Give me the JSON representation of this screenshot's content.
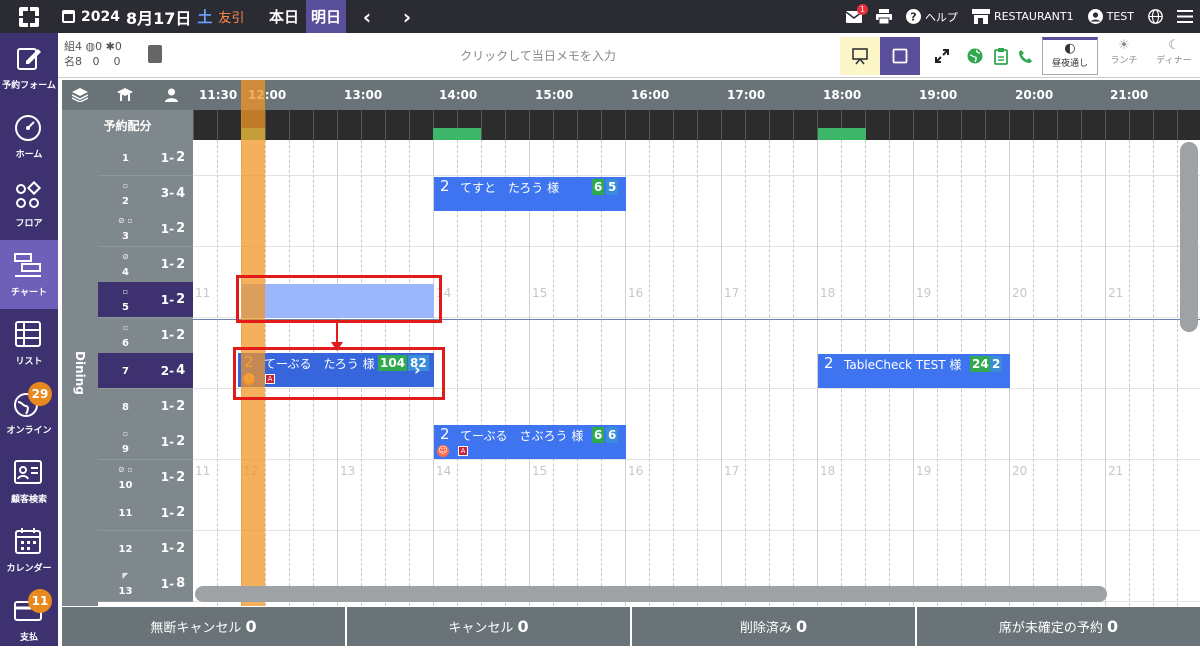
{
  "header": {
    "year": "2024",
    "month_day": "8月17日",
    "weekday": "土",
    "rokuyo": "友引",
    "today_label": "本日",
    "tomorrow_label": "明日",
    "prev_arrow": "‹",
    "next_arrow": "›",
    "mail_badge": "1",
    "help_label": "ヘルプ",
    "restaurant_label": "RESTAURANT1",
    "user_label": "TEST"
  },
  "sidebar": {
    "items": [
      {
        "label": "予約フォーム",
        "icon": "pencil-icon"
      },
      {
        "label": "ホーム",
        "icon": "gauge-icon"
      },
      {
        "label": "フロア",
        "icon": "floor-shapes-icon"
      },
      {
        "label": "チャート",
        "icon": "chart-icon"
      },
      {
        "label": "リスト",
        "icon": "list-icon"
      },
      {
        "label": "オンライン",
        "icon": "globe-icon",
        "badge": "29"
      },
      {
        "label": "顧客検索",
        "icon": "customer-card-icon"
      },
      {
        "label": "カレンダー",
        "icon": "calendar-icon"
      },
      {
        "label": "支払",
        "icon": "payment-card-icon",
        "badge": "11"
      }
    ]
  },
  "infobar": {
    "groups_label": "組",
    "groups_count": "4",
    "online_count": "0",
    "walkin_count": "0",
    "people_label": "名",
    "people_count": "8",
    "online_people": "0",
    "walkin_people": "0",
    "memo_placeholder": "クリックして当日メモを入力",
    "meal_all_label": "昼夜通し",
    "meal_lunch_label": "ランチ",
    "meal_dinner_label": "ディナー"
  },
  "grid": {
    "alloc_label": "予約配分",
    "area_label": "Dining",
    "time_labels": [
      "11:30",
      "12:00",
      "13:00",
      "14:00",
      "15:00",
      "16:00",
      "17:00",
      "18:00",
      "19:00",
      "20:00",
      "21:00"
    ],
    "ghost_hours": [
      "11",
      "12",
      "13",
      "14",
      "15",
      "16",
      "17",
      "18",
      "19",
      "20",
      "21"
    ],
    "tables": [
      {
        "name": "1",
        "min": "1",
        "max": "2"
      },
      {
        "name": "2",
        "min": "3",
        "max": "4"
      },
      {
        "name": "3",
        "min": "1",
        "max": "2"
      },
      {
        "name": "4",
        "min": "1",
        "max": "2"
      },
      {
        "name": "5",
        "min": "1",
        "max": "2"
      },
      {
        "name": "6",
        "min": "1",
        "max": "2"
      },
      {
        "name": "7",
        "min": "2",
        "max": "4"
      },
      {
        "name": "8",
        "min": "1",
        "max": "2"
      },
      {
        "name": "9",
        "min": "1",
        "max": "2"
      },
      {
        "name": "10",
        "min": "1",
        "max": "2"
      },
      {
        "name": "11",
        "min": "1",
        "max": "2"
      },
      {
        "name": "12",
        "min": "1",
        "max": "2"
      },
      {
        "name": "13",
        "min": "1",
        "max": "8"
      }
    ],
    "reservations": [
      {
        "pax": "2",
        "name": "てすと　たろう 様",
        "chip1": "6",
        "chip2": "5"
      },
      {
        "pax": "2",
        "name": "てーぶる　たろう 様",
        "chip1": "104",
        "chip2": "82",
        "tag": "A"
      },
      {
        "pax": "2",
        "name": "TableCheck TEST 様",
        "chip1": "24",
        "chip2": "2"
      },
      {
        "pax": "2",
        "name": "てーぶる　さぶろう 様",
        "chip1": "6",
        "chip2": "6",
        "tag": "A"
      }
    ]
  },
  "footer": {
    "no_show_label": "無断キャンセル",
    "no_show_count": "0",
    "cancel_label": "キャンセル",
    "cancel_count": "0",
    "deleted_label": "削除済み",
    "deleted_count": "0",
    "unassigned_label": "席が未確定の予約",
    "unassigned_count": "0"
  }
}
